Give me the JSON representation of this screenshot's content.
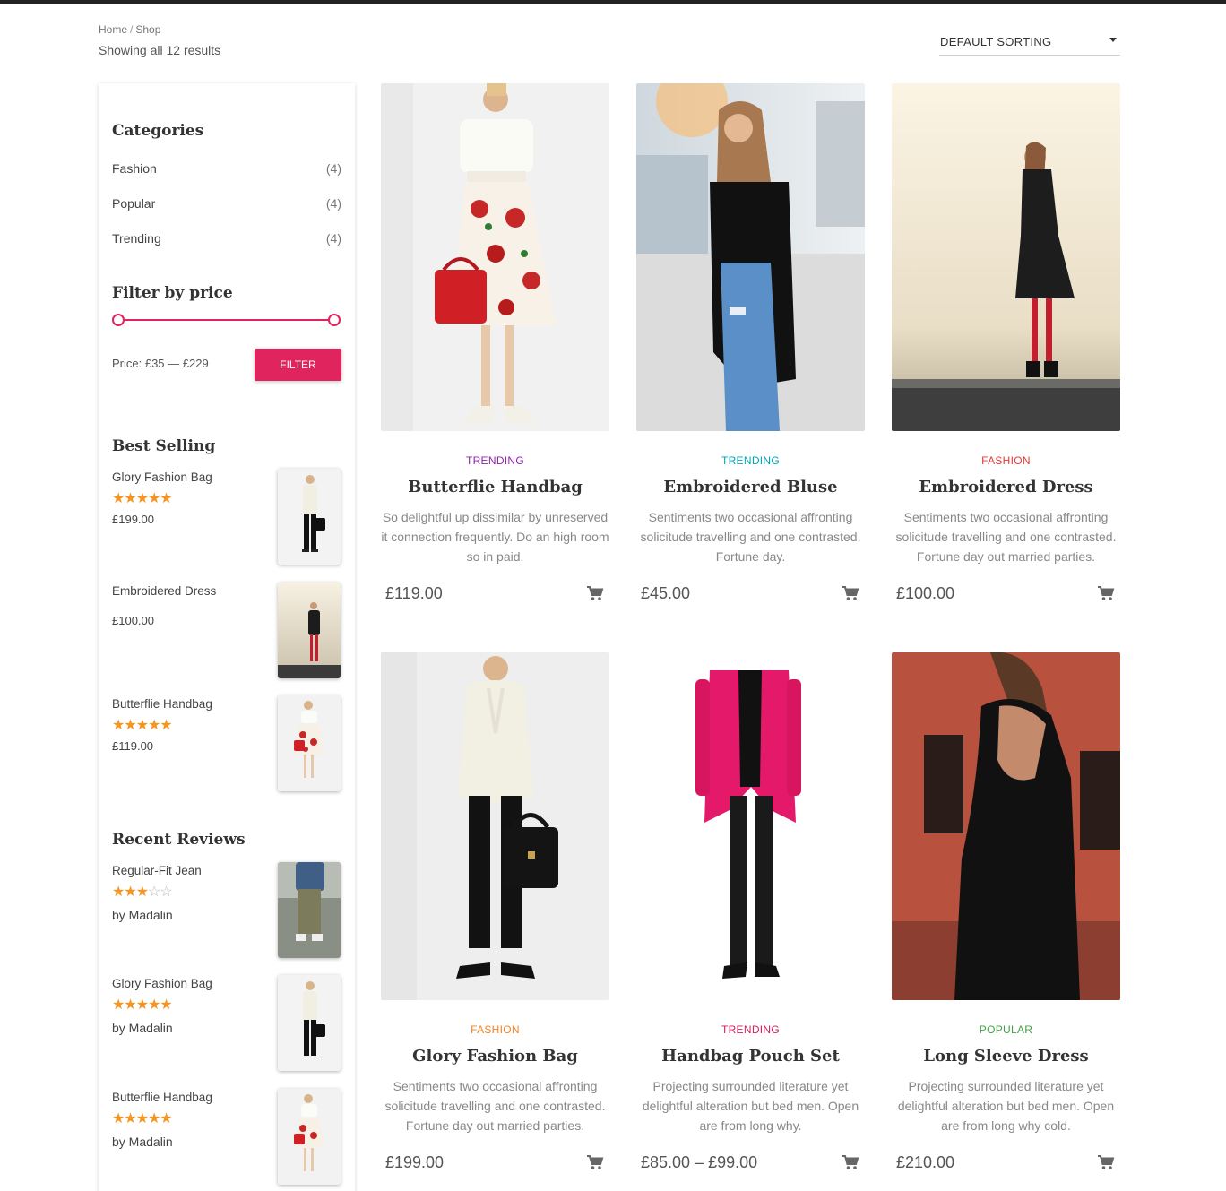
{
  "breadcrumb": {
    "home": "Home",
    "separator": "/",
    "current": "Shop"
  },
  "results_text": "Showing all 12 results",
  "sorting": {
    "selected": "DEFAULT SORTING"
  },
  "sidebar": {
    "categories": {
      "title": "Categories",
      "items": [
        {
          "label": "Fashion",
          "count": "(4)"
        },
        {
          "label": "Popular",
          "count": "(4)"
        },
        {
          "label": "Trending",
          "count": "(4)"
        }
      ]
    },
    "price_filter": {
      "title": "Filter by price",
      "range_min": 0,
      "range_max": 1,
      "price_label": "Price: £35 — £229",
      "button": "FILTER"
    },
    "best_selling": {
      "title": "Best Selling",
      "items": [
        {
          "name": "Glory Fashion Bag",
          "rating": 5,
          "price": "£199.00"
        },
        {
          "name": "Embroidered Dress",
          "rating": 0,
          "price": "£100.00"
        },
        {
          "name": "Butterflie Handbag",
          "rating": 5,
          "price": "£119.00"
        }
      ]
    },
    "recent_reviews": {
      "title": "Recent Reviews",
      "items": [
        {
          "name": "Regular-Fit Jean",
          "rating": 3,
          "by": "by Madalin"
        },
        {
          "name": "Glory Fashion Bag",
          "rating": 5,
          "by": "by Madalin"
        },
        {
          "name": "Butterflie Handbag",
          "rating": 5,
          "by": "by Madalin"
        }
      ]
    }
  },
  "colors": {
    "accent": "#e0245e",
    "star": "#f7941d",
    "trending_purple": "#8e24aa",
    "trending_teal": "#00a5b5",
    "fashion_red": "#e53935",
    "fashion_orange": "#f58220",
    "trending_pink": "#d81b60",
    "popular_green": "#43a047"
  },
  "products": [
    {
      "category": "TRENDING",
      "title": "Butterflie Handbag",
      "desc": "So delightful up dissimilar by unreserved it connection frequently. Do an high room so in paid.",
      "price": "£119.00"
    },
    {
      "category": "TRENDING",
      "title": "Embroidered Bluse",
      "desc": "Sentiments two occasional affronting solicitude travelling and one contrasted. Fortune day.",
      "price": "£45.00"
    },
    {
      "category": "FASHION",
      "title": "Embroidered Dress",
      "desc": "Sentiments two occasional affronting solicitude travelling and one contrasted. Fortune day out married parties.",
      "price": "£100.00"
    },
    {
      "category": "FASHION",
      "title": "Glory Fashion Bag",
      "desc": "Sentiments two occasional affronting solicitude travelling and one contrasted. Fortune day out married parties.",
      "price": "£199.00"
    },
    {
      "category": "TRENDING",
      "title": "Handbag Pouch Set",
      "desc": "Projecting surrounded literature yet delightful alteration but bed men. Open are from long why.",
      "price": "£85.00 – £99.00"
    },
    {
      "category": "POPULAR",
      "title": "Long Sleeve Dress",
      "desc": "Projecting surrounded literature yet delightful alteration but bed men. Open are from long why cold.",
      "price": "£210.00"
    }
  ]
}
